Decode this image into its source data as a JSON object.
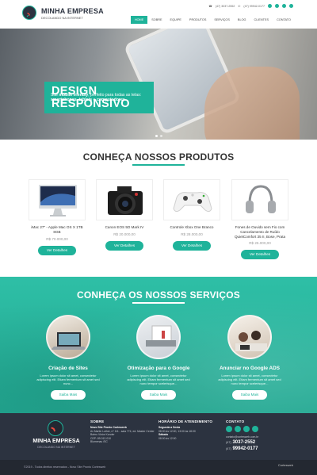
{
  "header": {
    "brand": "MINHA EMPRESA",
    "tagline": "DECOLANDO NA INTERNET",
    "phone1": "(47) 3037-2552",
    "phone2": "(47) 99942-0177",
    "nav": [
      "HOME",
      "SOBRE",
      "EQUIPE",
      "PRODUTOS",
      "SERVIÇOS",
      "BLOG",
      "CLIENTES",
      "CONTATO"
    ]
  },
  "hero": {
    "title_line1": "DESIGN",
    "title_line2": "RESPONSIVO",
    "desc_1": "Site ",
    "desc_bold1": "mobile friendly",
    "desc_2": ", perfeito para todas as telas: ",
    "desc_bold2": "smartphones, tablets",
    "desc_3": " e ",
    "desc_bold3": "computadores",
    "desc_4": "."
  },
  "products": {
    "title": "CONHEÇA NOSSOS PRODUTOS",
    "items": [
      {
        "name": "iMac 27\" - Apple Mac OS X 1TB 8GB",
        "price": "R$ 70.000,00",
        "button": "Ver Detalhes"
      },
      {
        "name": "Canon EOS 5D Mark IV",
        "price": "R$ 20.000,00",
        "button": "Ver Detalhes"
      },
      {
        "name": "Controle Xbox One Branco",
        "price": "R$ 28.000,00",
        "button": "Ver Detalhes"
      },
      {
        "name": "Fones de Ouvido sem Fio com Cancelamento de Ruído QuietComfort 35 II, Bose, Prata",
        "price": "R$ 25.000,00",
        "button": "Ver Detalhes"
      }
    ]
  },
  "services": {
    "title": "CONHEÇA OS NOSSOS SERVIÇOS",
    "items": [
      {
        "name": "Criação de Sites",
        "text": "Lorem ipsum dolor sit amet, consectetur adipiscing elit. Etiam fermentum sit amet sed nunc...",
        "button": "Saiba Mais"
      },
      {
        "name": "Otimização para o Google",
        "text": "Lorem ipsum dolor sit amet, consectetur adipiscing elit. Etiam fermentum sit amet sed nunc tempor scelerisque...",
        "button": "Saiba Mais"
      },
      {
        "name": "Anunciar no Google ADS",
        "text": "Lorem ipsum dolor sit amet, consectetur adipiscing elit. Etiam fermentum sit amet sed nunc tempor scelerisque...",
        "button": "Saiba Mais"
      }
    ]
  },
  "footer": {
    "brand": "MINHA EMPRESA",
    "tagline": "DECOLANDO NA INTERNET",
    "about_title": "SOBRE",
    "about_company": "Novo Site Pronto Cortesweb",
    "about_lines": [
      "Av Martin Luther, nº 111 - sala 774, ed. Master Center",
      "Bairro Victor Konder",
      "CEP: 89.012-010",
      "Blumenau /SC"
    ],
    "hours_title": "HORÁRIO DE ATENDIMENTO",
    "hours_days1": "Segunda a Sexta",
    "hours_time1": "08:00 às 12:00, 13:00 às 18:00",
    "hours_days2": "Sábado",
    "hours_time2": "08:00 às 12:00",
    "contact_title": "CONTATO",
    "email": "contato@cortesweb.com.br",
    "phone1_prefix": "(47)",
    "phone1": "3037-2552",
    "phone2_prefix": "(47)",
    "phone2": "99942-0177",
    "copyright": "©2019 - Todos direitos reservados - Novo Site Pronto Cortesweb",
    "credit": "Cortesweb"
  },
  "colors": {
    "accent": "#1fb39a",
    "dark": "#2c3340"
  }
}
